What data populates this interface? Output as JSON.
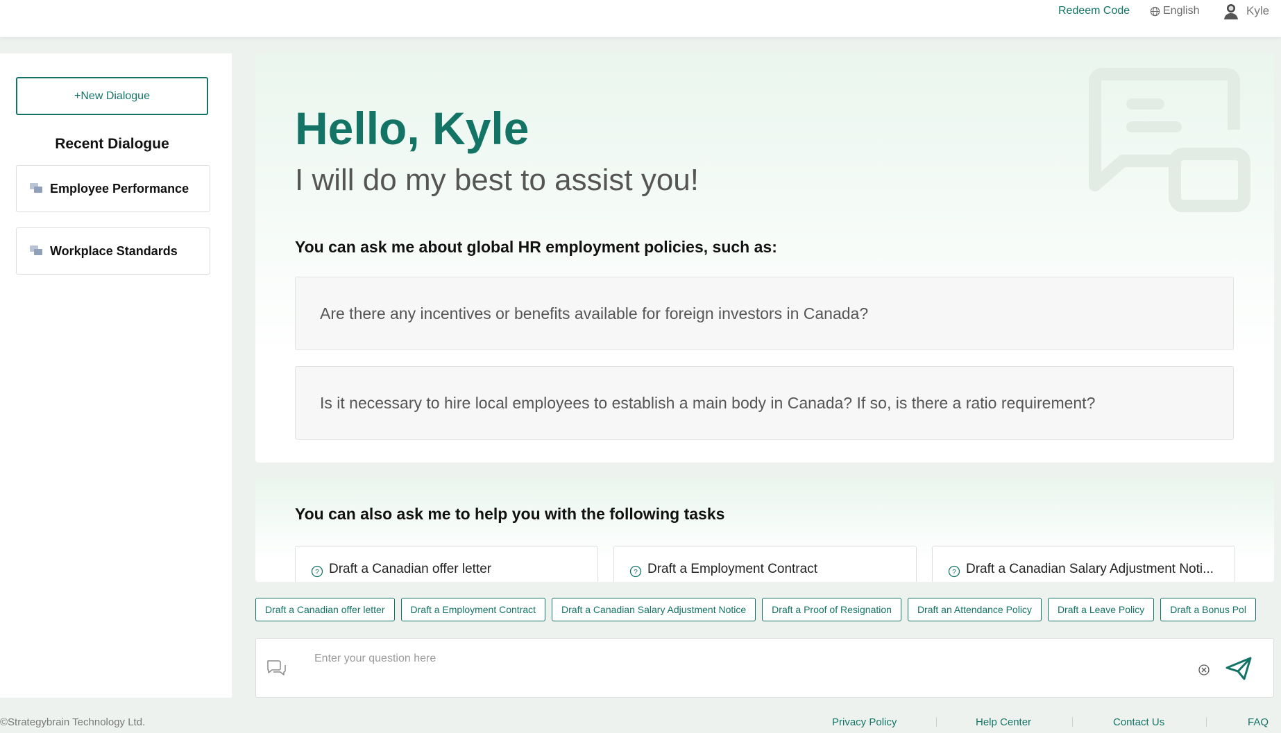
{
  "header": {
    "redeem_label": "Redeem Code",
    "language_label": "English",
    "user_name": "Kyle"
  },
  "sidebar": {
    "new_dialogue_label": "+New Dialogue",
    "recent_title": "Recent Dialogue",
    "items": [
      {
        "label": "Employee Performance"
      },
      {
        "label": "Workplace Standards"
      }
    ]
  },
  "main": {
    "greeting": "Hello, Kyle",
    "subtitle": "I will do my best to assist you!",
    "ask_title": "You can ask me about global HR employment policies, such as:",
    "questions": [
      "Are there any incentives or benefits available for foreign investors in Canada?",
      "Is it necessary to hire local employees to establish a main body in Canada? If so, is there a ratio requirement?"
    ]
  },
  "tasks": {
    "title": "You can also ask me to help you with the following tasks",
    "cards": [
      "Draft a Canadian offer letter",
      "Draft a Employment Contract",
      "Draft a Canadian Salary Adjustment Noti..."
    ]
  },
  "chips": [
    "Draft a Canadian offer letter",
    "Draft a Employment Contract",
    "Draft a Canadian Salary Adjustment Notice",
    "Draft a Proof of Resignation",
    "Draft an Attendance Policy",
    "Draft a Leave Policy",
    "Draft a Bonus Pol"
  ],
  "input": {
    "placeholder": "Enter your question here"
  },
  "footer": {
    "copyright": "©Strategybrain Technology Ltd.",
    "links": [
      "Privacy Policy",
      "Help Center",
      "Contact Us",
      "FAQ"
    ]
  },
  "colors": {
    "brand": "#137466",
    "background": "#eef2ef"
  }
}
